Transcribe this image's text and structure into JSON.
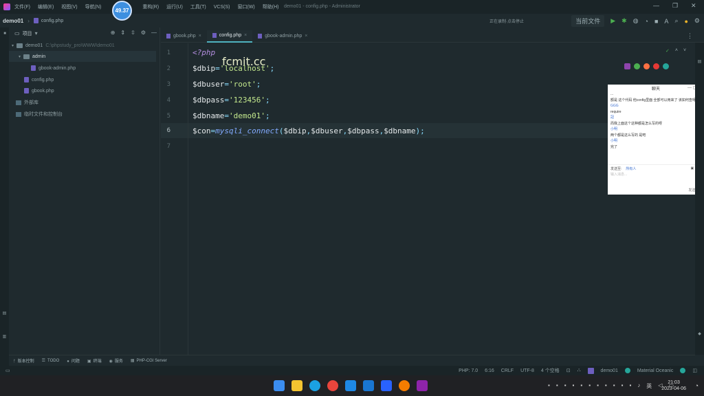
{
  "menubar": {
    "items": [
      "文件(F)",
      "编辑(E)",
      "视图(V)",
      "导航(N)",
      "",
      "",
      "重构(R)",
      "运行(U)",
      "工具(T)",
      "VCS(S)",
      "窗口(W)",
      "帮助(H)"
    ],
    "window_title": "demo01 - config.php - Administrator",
    "timer": "49.37"
  },
  "navbar": {
    "project": "demo01",
    "file": "config.php",
    "recorder": "正在录制·点击停止",
    "run_config": "当前文件"
  },
  "project_panel": {
    "title": "项目",
    "tree": [
      {
        "label": "demo01",
        "path": "C:\\phpstudy_pro\\WWW\\demo01",
        "kind": "folder"
      },
      {
        "label": "admin",
        "kind": "folder"
      },
      {
        "label": "gbook-admin.php",
        "kind": "php"
      },
      {
        "label": "config.php",
        "kind": "php"
      },
      {
        "label": "gbook.php",
        "kind": "php"
      },
      {
        "label": "外部库",
        "kind": "lib"
      },
      {
        "label": "临时文件和控制台",
        "kind": "lib"
      }
    ]
  },
  "tabs": [
    {
      "label": "gbook.php"
    },
    {
      "label": "config.php"
    },
    {
      "label": "gbook-admin.php"
    }
  ],
  "editor": {
    "lines": [
      {
        "no": "1",
        "text": "<?php"
      },
      {
        "no": "2",
        "text": "$dbip='localhost';"
      },
      {
        "no": "3",
        "text": "$dbuser='root';"
      },
      {
        "no": "4",
        "text": "$dbpass='123456';"
      },
      {
        "no": "5",
        "text": "$dbname='demo01';"
      },
      {
        "no": "6",
        "text": "$con=mysqli_connect($dbip,$dbuser,$dbpass,$dbname);"
      },
      {
        "no": "7",
        "text": ""
      }
    ],
    "watermark": "fcmit.cc"
  },
  "chat": {
    "title": "聊天",
    "messages": [
      {
        "text": "...",
        "name": false
      },
      {
        "text": "额是 这个代码 他config里面 全部可以用来了 该如何查呀",
        "name": false
      },
      {
        "text": "GGG",
        "name": true
      },
      {
        "text": "require",
        "name": false
      },
      {
        "text": "冠",
        "name": true
      },
      {
        "text": "而我上面这个这种都是怎么写的呀",
        "name": false
      },
      {
        "text": "小明",
        "name": true
      },
      {
        "text": "两个都是这么写的 是吧",
        "name": false
      },
      {
        "text": "小明",
        "name": true
      },
      {
        "text": "完了",
        "name": false
      }
    ],
    "send_to_label": "发送至:",
    "send_to_value": "所有人",
    "placeholder": "输入消息...",
    "send_label": "发送(S)"
  },
  "toolwindows": [
    "版本控制",
    "TODO",
    "问题",
    "终端",
    "服务",
    "PHP-CGI Server"
  ],
  "status": {
    "php": "PHP: 7.0",
    "pos": "6:16",
    "eol": "CRLF",
    "encoding": "UTF-8",
    "indent": "4 个空格",
    "project": "demo01",
    "theme": "Material Oceanic"
  },
  "taskbar": {
    "ime": "英",
    "time": "21:03",
    "date": "2023-04-06"
  },
  "colors": {
    "accent": "#4fb3c0",
    "background": "#1f2a2e"
  }
}
